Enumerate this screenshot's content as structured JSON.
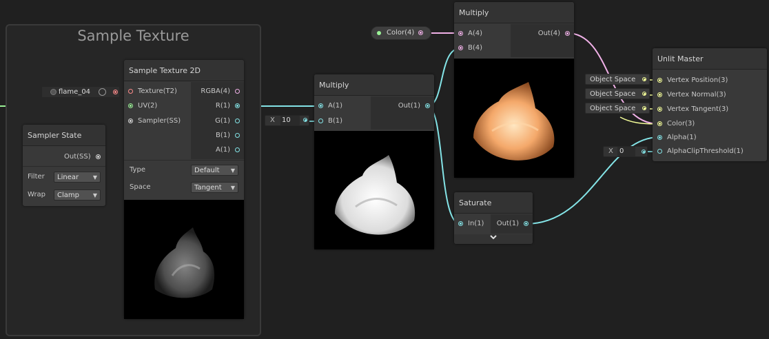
{
  "group": {
    "title": "Sample Texture"
  },
  "texture_property": {
    "name": "flame_04"
  },
  "sampler_state": {
    "title": "Sampler State",
    "output": "Out(SS)",
    "filter_label": "Filter",
    "filter_value": "Linear",
    "wrap_label": "Wrap",
    "wrap_value": "Clamp"
  },
  "sample_texture": {
    "title": "Sample Texture 2D",
    "inputs": [
      "Texture(T2)",
      "UV(2)",
      "Sampler(SS)"
    ],
    "outputs": [
      "RGBA(4)",
      "R(1)",
      "G(1)",
      "B(1)",
      "A(1)"
    ],
    "type_label": "Type",
    "type_value": "Default",
    "space_label": "Space",
    "space_value": "Tangent"
  },
  "multiply_mid": {
    "title": "Multiply",
    "inputs": [
      "A(1)",
      "B(1)"
    ],
    "output": "Out(1)",
    "b_field_axis": "X",
    "b_field_value": "10"
  },
  "color_property": {
    "label": "Color(4)"
  },
  "multiply_top": {
    "title": "Multiply",
    "inputs": [
      "A(4)",
      "B(4)"
    ],
    "output": "Out(4)"
  },
  "saturate": {
    "title": "Saturate",
    "input": "In(1)",
    "output": "Out(1)",
    "expand_icon": "chevron-down"
  },
  "unlit_master": {
    "title": "Unlit Master",
    "inputs": [
      "Vertex Position(3)",
      "Vertex Normal(3)",
      "Vertex Tangent(3)",
      "Color(3)",
      "Alpha(1)",
      "AlphaClipThreshold(1)"
    ],
    "space_tags": [
      "Object Space",
      "Object Space",
      "Object Space"
    ],
    "alpha_clip_axis": "X",
    "alpha_clip_value": "0"
  },
  "colors": {
    "background": "#202020",
    "node": "#393939",
    "wire_cyan": "#84e4e7",
    "wire_pink": "#f1b1e8",
    "wire_green": "#9bf397",
    "wire_white": "#d9d9d9",
    "wire_yellow": "#f6ff9a",
    "wire_red": "#ff8b8b"
  }
}
